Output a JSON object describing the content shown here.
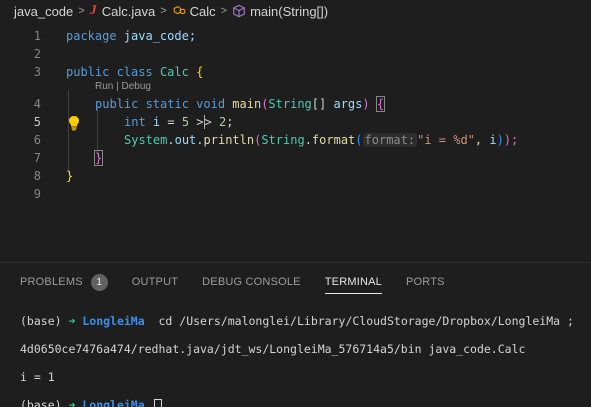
{
  "breadcrumb": {
    "folder": "java_code",
    "file": "Calc.java",
    "class_name": "Calc",
    "method": "main(String[])"
  },
  "editor": {
    "codelens": {
      "run": "Run",
      "sep": " | ",
      "debug": "Debug"
    },
    "active_line": 5,
    "lines": [
      {
        "n": "1"
      },
      {
        "n": "2"
      },
      {
        "n": "3"
      },
      {
        "n": "4"
      },
      {
        "n": "5"
      },
      {
        "n": "6"
      },
      {
        "n": "7"
      },
      {
        "n": "8"
      },
      {
        "n": "9"
      }
    ],
    "tokens": {
      "l1_kw": "package",
      "l1_rest": " java_code;",
      "l3_kw1": "public",
      "l3_kw2": " class ",
      "l3_cls": "Calc",
      "l3_brace": " {",
      "l4_kw": "public static void ",
      "l4_fn": "main",
      "l4_p1": "(",
      "l4_type": "String",
      "l4_arr": "[] ",
      "l4_var": "args",
      "l4_p2": ") ",
      "l4_brace": "{",
      "l5_type": "int",
      "l5_var": " i",
      "l5_eq": " = ",
      "l5_num": "5",
      "l5_op1": " >",
      "l5_op2": "> ",
      "l5_num2": "2",
      "l5_semi": ";",
      "l6_cls": "System",
      "l6_dot1": ".",
      "l6_out": "out",
      "l6_dot2": ".",
      "l6_fn": "println",
      "l6_p1": "(",
      "l6_cls2": "String",
      "l6_dot3": ".",
      "l6_fn2": "format",
      "l6_p2": "(",
      "l6_hint": "format:",
      "l6_str": "\"i = %d\"",
      "l6_comma": ", ",
      "l6_var": "i",
      "l6_p3": ")",
      "l6_p4": ");",
      "l7_brace": "}",
      "l8_brace": "}"
    }
  },
  "panel": {
    "tabs": [
      {
        "label": "PROBLEMS",
        "badge": "1"
      },
      {
        "label": "OUTPUT"
      },
      {
        "label": "DEBUG CONSOLE"
      },
      {
        "label": "TERMINAL",
        "active": true
      },
      {
        "label": "PORTS"
      }
    ]
  },
  "terminal": {
    "line1_prefix": "(base) ",
    "arrow": "➜",
    "dir": "LongleiMa",
    "line1_cmd": "  cd /Users/malonglei/Library/CloudStorage/Dropbox/LongleiMa ; ",
    "line2": "4d0650ce7476a474/redhat.java/jdt_ws/LongleiMa_576714a5/bin java_code.Calc",
    "line3": "i = 1",
    "line4_prefix": "(base) "
  },
  "colors": {
    "background": "#1e1e1e",
    "keyword": "#569cd6",
    "type": "#4ec9b0",
    "function": "#dcdcaa",
    "string": "#ce9178",
    "variable": "#9cdcfe",
    "terminal_arrow": "#23d18b",
    "terminal_dir": "#3b8eea"
  }
}
